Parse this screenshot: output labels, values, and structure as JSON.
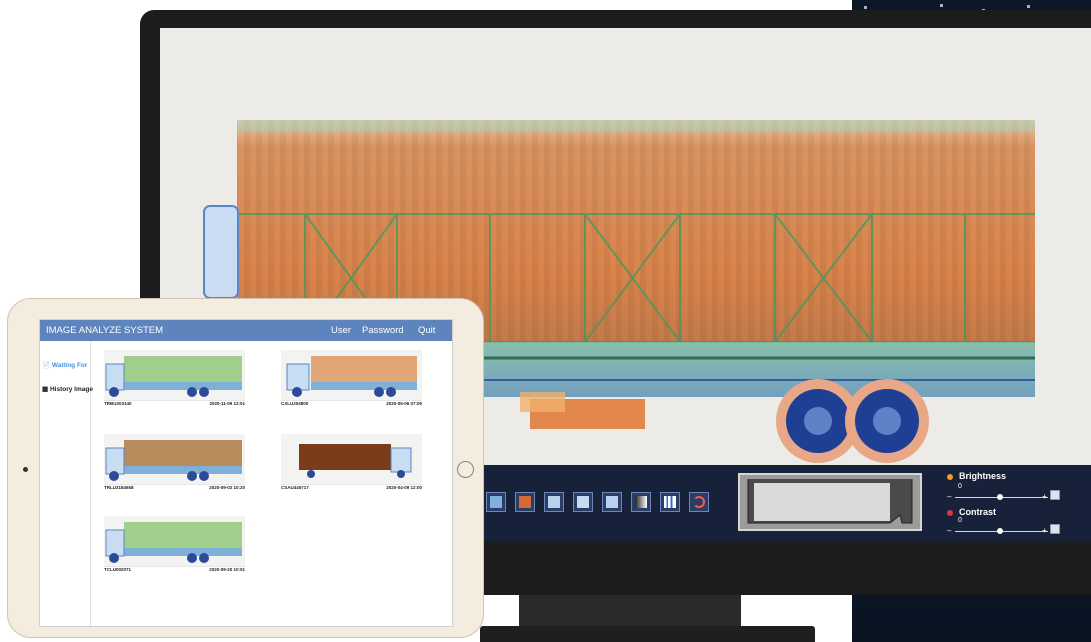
{
  "monitor": {
    "toolbar": {
      "tools": [
        "image-mode-icon",
        "color-mode-icon",
        "filter-1-icon",
        "filter-2-icon",
        "filter-3-icon",
        "grayscale-icon",
        "histogram-icon",
        "undo-icon"
      ],
      "brightness": {
        "label": "Brightness",
        "value_label": "0",
        "minus": "–",
        "plus": "+",
        "level": 0.5,
        "dot_color": "#f39a2b"
      },
      "contrast": {
        "label": "Contrast",
        "value_label": "0",
        "minus": "–",
        "plus": "+",
        "level": 0.5,
        "dot_color": "#e0333a"
      }
    }
  },
  "tablet": {
    "app_title": "IMAGE ANALYZE SYSTEM",
    "nav": {
      "user": "User",
      "password": "Password",
      "quit": "Quit"
    },
    "sidebar": {
      "waiting": {
        "label": "Waiting For",
        "icon": "document-icon",
        "color": "#4d8fd6"
      },
      "history": {
        "label": "History Image",
        "icon": "image-icon",
        "color": "#222222"
      }
    },
    "cards": [
      {
        "id": "TRBU203140",
        "time": "2020-11-09  12:01",
        "kind": "green"
      },
      {
        "id": "CXLU204800",
        "time": "2020-05-06  07:05",
        "kind": "orange"
      },
      {
        "id": "TRLU3184658",
        "time": "2020-09-02  10:20",
        "kind": "orange"
      },
      {
        "id": "CSAU445717",
        "time": "2020-04-09  12:00",
        "kind": "brown"
      },
      {
        "id": "TCLU002071",
        "time": "2020-09-20  10:01",
        "kind": "green"
      }
    ]
  }
}
